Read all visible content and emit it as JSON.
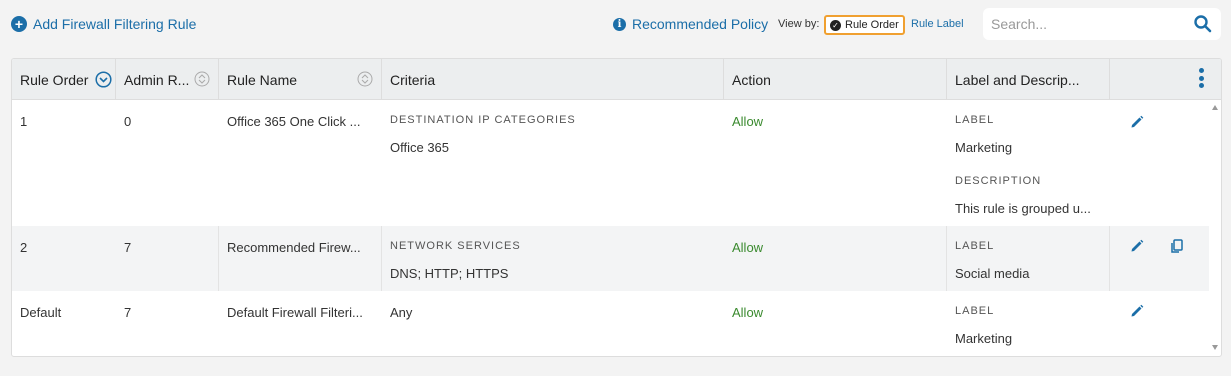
{
  "toolbar": {
    "add_rule_label": "Add Firewall Filtering Rule",
    "recommended_policy_label": "Recommended Policy",
    "view_by_label": "View by:",
    "rule_order_label": "Rule Order",
    "rule_label_label": "Rule Label",
    "search_placeholder": "Search..."
  },
  "columns": [
    "Rule Order",
    "Admin R...",
    "Rule Name",
    "Criteria",
    "Action",
    "Label and Descrip..."
  ],
  "rows": [
    {
      "rule_order": "1",
      "admin_rank": "0",
      "rule_name": "Office 365 One Click ...",
      "criteria_label": "DESTINATION IP CATEGORIES",
      "criteria_value": "Office 365",
      "action": "Allow",
      "label_heading": "LABEL",
      "label_value": "Marketing",
      "description_heading": "DESCRIPTION",
      "description_value": "This rule is grouped u..."
    },
    {
      "rule_order": "2",
      "admin_rank": "7",
      "rule_name": "Recommended Firew...",
      "criteria_label": "NETWORK SERVICES",
      "criteria_value": "DNS; HTTP; HTTPS",
      "action": "Allow",
      "label_heading": "LABEL",
      "label_value": "Social media"
    },
    {
      "rule_order": "Default",
      "admin_rank": "7",
      "rule_name": "Default Firewall Filteri...",
      "criteria_value": "Any",
      "action": "Allow",
      "label_heading": "LABEL",
      "label_value": "Marketing"
    }
  ],
  "colors": {
    "accent": "#1b6ea8",
    "allow": "#3a8a2e",
    "highlight_border": "#f0a030"
  }
}
